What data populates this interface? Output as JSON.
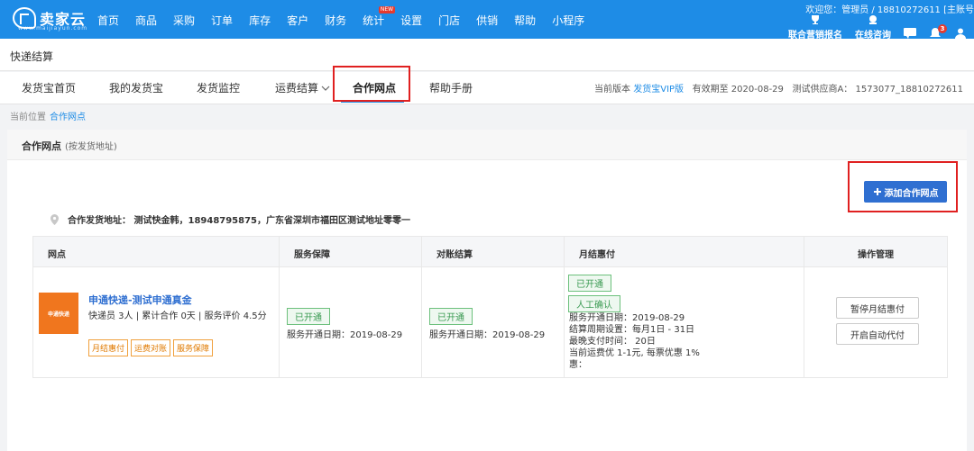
{
  "app": {
    "logo_text": "卖家云",
    "logo_sub": "www.maijiayun.com",
    "nav": [
      "首页",
      "商品",
      "采购",
      "订单",
      "库存",
      "客户",
      "财务",
      "统计",
      "设置",
      "门店",
      "供销",
      "帮助",
      "小程序"
    ],
    "nav_new_badge": "NEW",
    "welcome": "欢迎您：管理员 / 18810272611 [主账号",
    "tools": {
      "marketing_label": "联合营销报名",
      "consult_label": "在线咨询",
      "bell_count": "3"
    }
  },
  "page": {
    "title": "快递结算"
  },
  "tabs": {
    "items": [
      "发货宝首页",
      "我的发货宝",
      "发货监控",
      "运费结算",
      "合作网点",
      "帮助手册"
    ],
    "active": "合作网点",
    "version_label": "当前版本",
    "version_value": "发货宝VIP版",
    "expiry": "有效期至 2020-08-29",
    "supplier": "测试供应商A： 1573077_18810272611"
  },
  "breadcrumb": {
    "label": "当前位置",
    "current": "合作网点"
  },
  "panel": {
    "title": "合作网点",
    "subtitle": "(按发货地址)",
    "add_button": "添加合作网点",
    "address": "合作发货地址： 测试快金韩，18948795875，广东省深圳市福田区测试地址零零一"
  },
  "table": {
    "headers": [
      "网点",
      "服务保障",
      "对账结算",
      "月结惠付",
      "操作管理"
    ],
    "row": {
      "logo_text": "申通快递",
      "carrier_name": "申通快递-测试申通真金",
      "meta": "快递员 3人 | 累计合作 0天 | 服务评价 4.5分",
      "tags": [
        "月结惠付",
        "运费对账",
        "服务保障"
      ],
      "service_status": "已开通",
      "service_date": "服务开通日期：2019-08-29",
      "recon_status": "已开通",
      "recon_date": "服务开通日期：2019-08-29",
      "monthly_status": "已开通",
      "monthly_confirm": "人工确认",
      "monthly_lines": [
        "服务开通日期：2019-08-29",
        "结算周期设置：每月1日 - 31日",
        "最晚支付时间： 20日",
        "当前运费优 1-1元, 每票优惠 1%",
        "惠："
      ],
      "op_pause": "暂停月结惠付",
      "op_auto": "开启自动代付"
    }
  },
  "colors": {
    "brand": "#1e8ce6",
    "button": "#2f6fd1",
    "highlight_box": "#e02020",
    "tag_orange": "#e07a00",
    "status_green": "#3a9a52"
  }
}
